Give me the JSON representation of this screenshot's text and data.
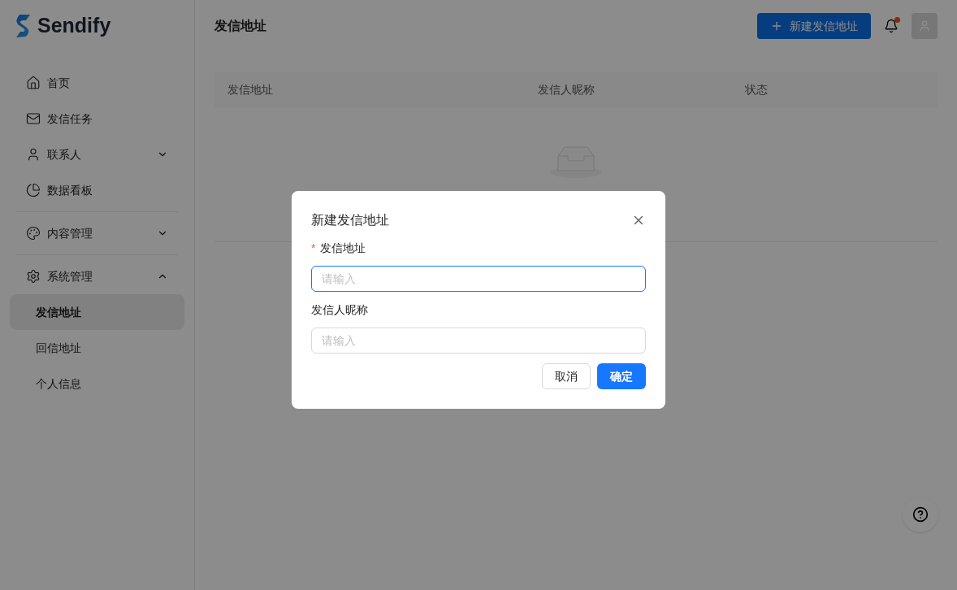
{
  "brand": {
    "name": "Sendify"
  },
  "sidebar": {
    "sections": [
      [
        {
          "label": "首页"
        },
        {
          "label": "发信任务"
        },
        {
          "label": "联系人",
          "expanded": false
        },
        {
          "label": "数据看板"
        }
      ],
      [
        {
          "label": "内容管理",
          "expanded": false
        }
      ],
      [
        {
          "label": "系统管理",
          "expanded": true,
          "children": [
            {
              "label": "发信地址",
              "selected": true
            },
            {
              "label": "回信地址",
              "selected": false
            },
            {
              "label": "个人信息",
              "selected": false
            }
          ]
        }
      ]
    ]
  },
  "header": {
    "title": "发信地址",
    "new_button": "新建发信地址",
    "notification_unread": true
  },
  "table": {
    "columns": [
      "发信地址",
      "发信人昵称",
      "状态"
    ]
  },
  "dialog": {
    "title": "新建发信地址",
    "fields": [
      {
        "required_mark": "*",
        "label": "发信地址",
        "placeholder": "请输入",
        "focused": true
      },
      {
        "label": "发信人昵称",
        "placeholder": "请输入",
        "focused": false
      }
    ],
    "buttons": [
      {
        "label": "取消",
        "kind": "default"
      },
      {
        "label": "确定",
        "kind": "primary"
      }
    ]
  }
}
